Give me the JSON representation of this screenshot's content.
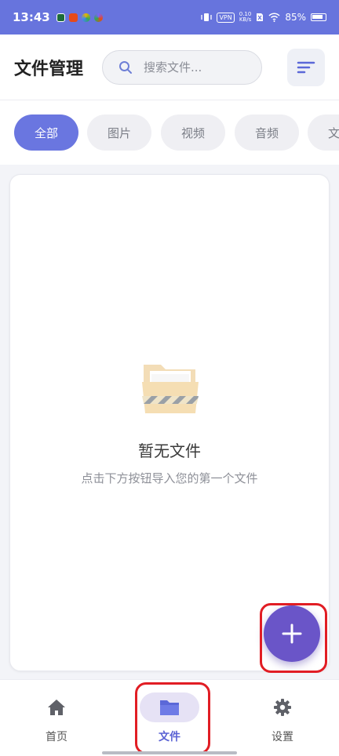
{
  "status_bar": {
    "time": "13:43",
    "vpn": "VPN",
    "net_speed_value": "0.10",
    "net_speed_unit": "KB/s",
    "battery": "85%",
    "notification_colors": [
      "#1d6b3a",
      "#e64a19",
      "#e5b400",
      "#7b61ff"
    ]
  },
  "header": {
    "title": "文件管理",
    "search_placeholder": "搜索文件...",
    "icons": {
      "search": "search-icon",
      "sort": "sort-icon"
    }
  },
  "filters": {
    "chips": [
      "全部",
      "图片",
      "视频",
      "音频",
      "文"
    ],
    "active": "全部"
  },
  "empty_state": {
    "title": "暂无文件",
    "subtitle": "点击下方按钮导入您的第一个文件",
    "icon": "folder-icon"
  },
  "fab": {
    "icon": "plus-icon"
  },
  "bottom_nav": {
    "items": [
      {
        "label": "首页",
        "icon": "home-icon"
      },
      {
        "label": "文件",
        "icon": "folder-icon"
      },
      {
        "label": "设置",
        "icon": "gear-icon"
      }
    ],
    "active": "文件"
  },
  "colors": {
    "accent": "#6a76e0",
    "fab": "#6a55c8",
    "status_bar": "#6774dd",
    "highlight_box": "#e11d24"
  }
}
